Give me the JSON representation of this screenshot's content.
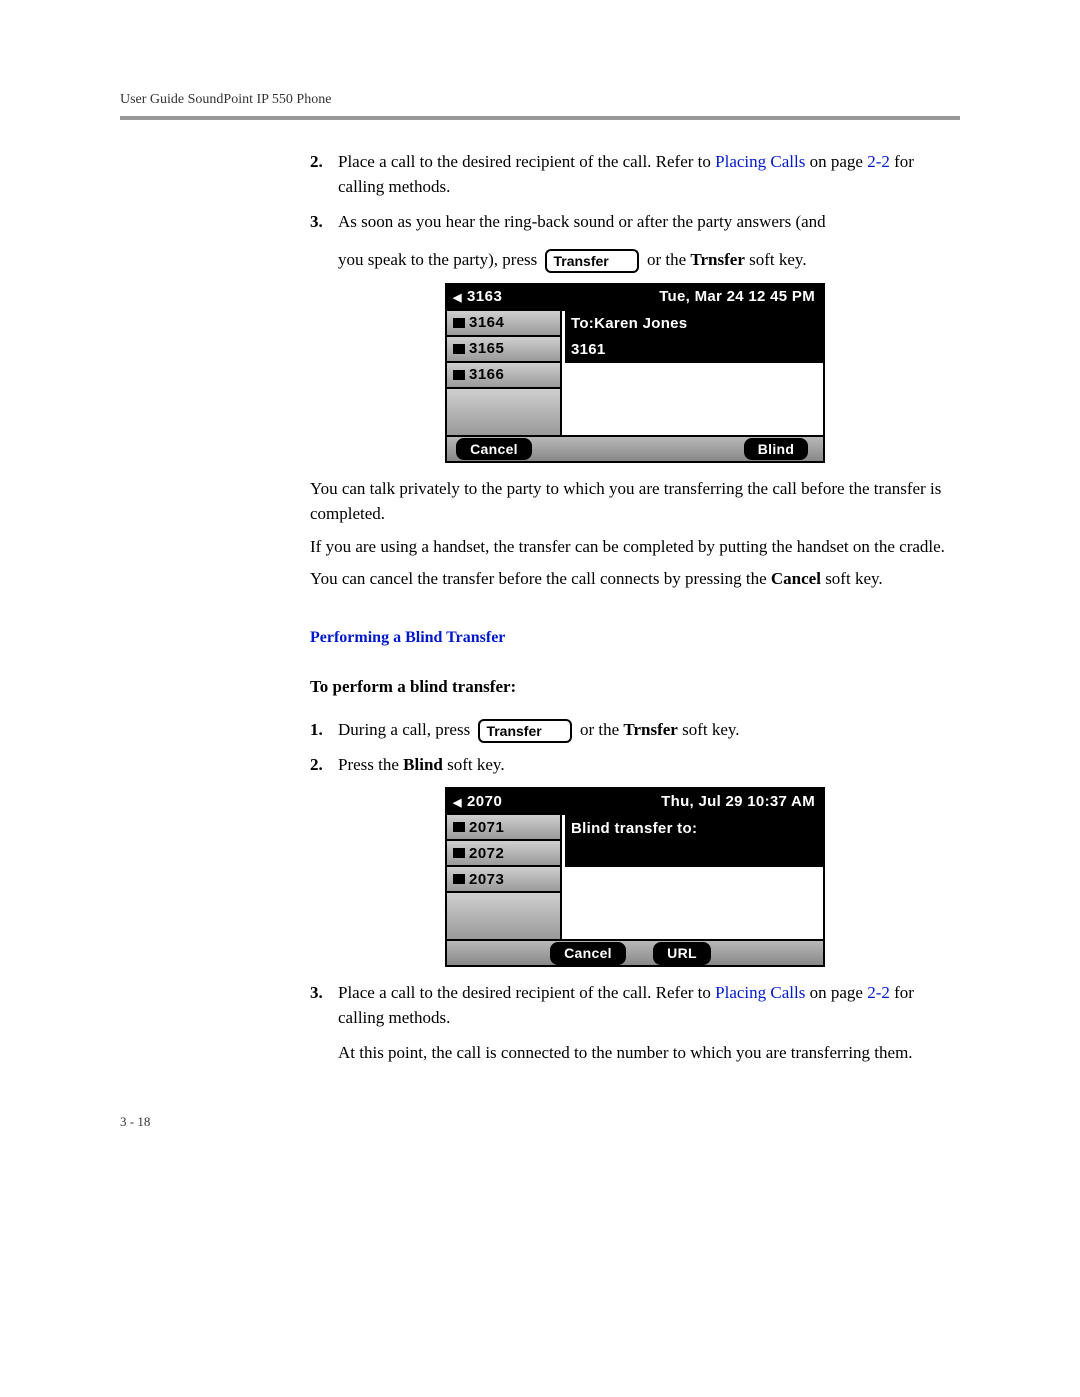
{
  "header": "User Guide SoundPoint IP 550 Phone",
  "footer": "3 - 18",
  "transfer_label": "Transfer",
  "steps1": [
    {
      "num": "2.",
      "pre": "Place a call to the desired recipient of the call. Refer to ",
      "link": "Placing Calls",
      "post1": " on page ",
      "link2": "2-2",
      "post2": " for calling methods."
    },
    {
      "num": "3.",
      "line1": "As soon as you hear the ring-back sound or after the party answers (and",
      "line2_pre": "you speak to the party), press ",
      "line2_post": " or the ",
      "line2_bold": "Trnsfer",
      "line2_end": " soft key."
    }
  ],
  "screen1": {
    "ext_active": "3163",
    "exts": [
      "3164",
      "3165",
      "3166"
    ],
    "date": "Tue, Mar 24  12 45 PM",
    "line1": "To:Karen Jones",
    "line2": "3161",
    "sk_left": "Cancel",
    "sk_right": "Blind"
  },
  "paras1": [
    "You can talk privately to the party to which you are transferring the call before the transfer is completed.",
    "If you are using a handset, the transfer can be completed by putting the handset on the cradle."
  ],
  "para_cancel_pre": "You can cancel the transfer before the call connects by pressing the ",
  "para_cancel_bold": "Cancel",
  "para_cancel_post": " soft key.",
  "section": "Performing a Blind Transfer",
  "sub": "To perform a blind transfer:",
  "steps2": {
    "s1_num": "1.",
    "s1_pre": "During a call, press ",
    "s1_post": " or the ",
    "s1_bold": "Trnsfer",
    "s1_end": " soft key.",
    "s2_num": "2.",
    "s2_pre": "Press the ",
    "s2_bold": "Blind",
    "s2_post": " soft key."
  },
  "screen2": {
    "ext_active": "2070",
    "exts": [
      "2071",
      "2072",
      "2073"
    ],
    "date": "Thu, Jul 29  10:37 AM",
    "line1": "Blind transfer to:",
    "sk_left": "Cancel",
    "sk_mid": "URL"
  },
  "step3": {
    "num": "3.",
    "pre": "Place a call to the desired recipient of the call. Refer to ",
    "link": "Placing Calls",
    "post1": " on page ",
    "link2": "2-2",
    "post2": " for calling methods."
  },
  "final_para": "At this point, the call is connected to the number to which you are transferring them."
}
